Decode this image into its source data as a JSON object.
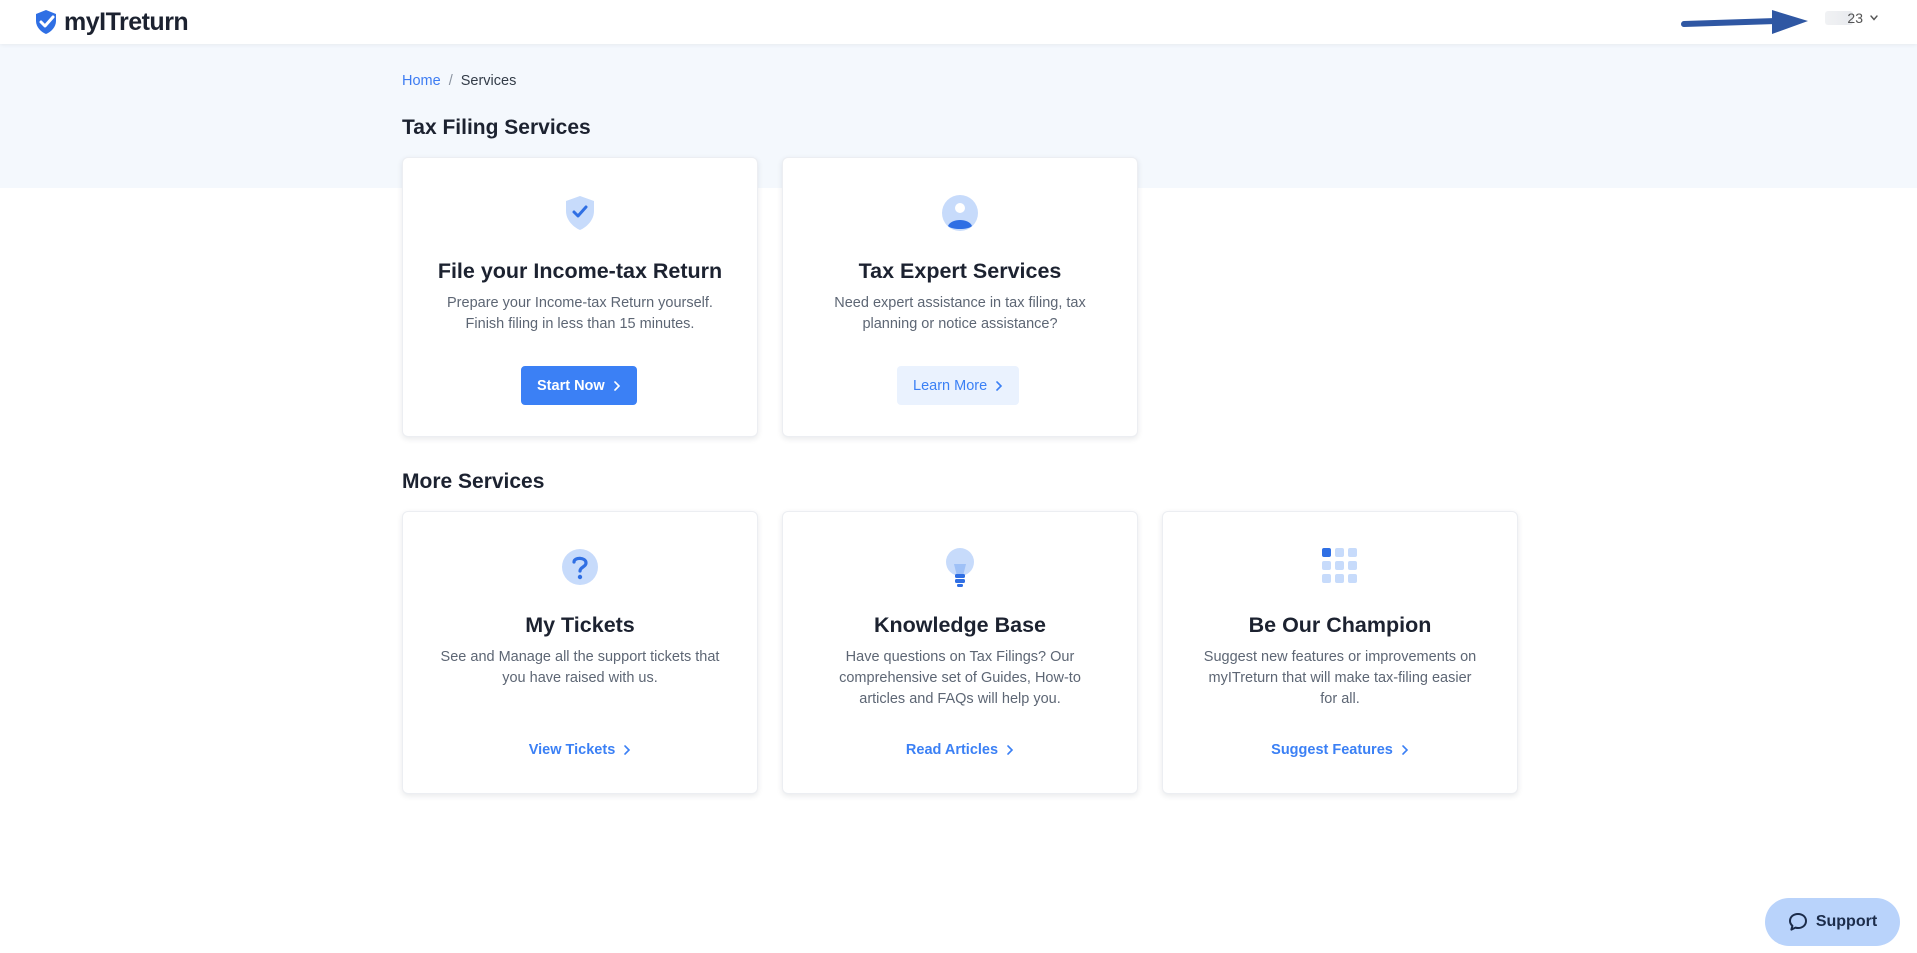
{
  "app": {
    "logo_text": "myITreturn"
  },
  "user_menu": {
    "masked_text": "23"
  },
  "colors": {
    "accent": "#3b80f5",
    "band": "#f4f8fd",
    "annotation_arrow": "#2f57a3"
  },
  "breadcrumb": {
    "home": "Home",
    "separator": "/",
    "current": "Services"
  },
  "sections": {
    "tax_filing": {
      "title": "Tax Filing Services",
      "cards": [
        {
          "icon": "shield-check-icon",
          "title": "File your Income-tax Return",
          "desc_line1": "Prepare your Income-tax Return yourself.",
          "desc_line2": "Finish filing in less than 15 minutes.",
          "button": "Start Now"
        },
        {
          "icon": "user-icon",
          "title": "Tax Expert Services",
          "desc_line1": "Need expert assistance in tax filing, tax",
          "desc_line2": "planning or notice assistance?",
          "button": "Learn More"
        }
      ]
    },
    "more": {
      "title": "More Services",
      "cards": [
        {
          "icon": "question-icon",
          "title": "My Tickets",
          "desc_line1": "See and Manage all the support tickets that",
          "desc_line2": "you have raised with us.",
          "link": "View Tickets"
        },
        {
          "icon": "lightbulb-icon",
          "title": "Knowledge Base",
          "desc_line1": "Have questions on Tax Filings? Our",
          "desc_line2": "comprehensive set of Guides, How-to",
          "desc_line3": "articles and FAQs will help you.",
          "link": "Read Articles"
        },
        {
          "icon": "grid-icon",
          "title": "Be Our Champion",
          "desc_line1": "Suggest new features or improvements on",
          "desc_line2": "myITreturn that will make tax-filing easier",
          "desc_line3": "for all.",
          "link": "Suggest Features"
        }
      ]
    }
  },
  "support": {
    "label": "Support"
  }
}
